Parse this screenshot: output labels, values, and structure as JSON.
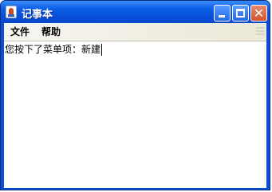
{
  "window": {
    "title": "记事本",
    "minimize_symbol": "",
    "maximize_symbol": "",
    "close_symbol": "✕"
  },
  "menubar": {
    "items": [
      {
        "label": "文件"
      },
      {
        "label": "帮助"
      }
    ]
  },
  "editor": {
    "text": "您按下了菜单项：新建"
  },
  "colors": {
    "titlebar": "#0b4fd9",
    "close_button": "#d4502e",
    "menubar": "#ece9d8",
    "editor_background": "#ffffff"
  },
  "icons": {
    "app": "java-cup-icon",
    "minimize": "minimize-icon",
    "maximize": "maximize-icon",
    "close": "close-icon"
  }
}
